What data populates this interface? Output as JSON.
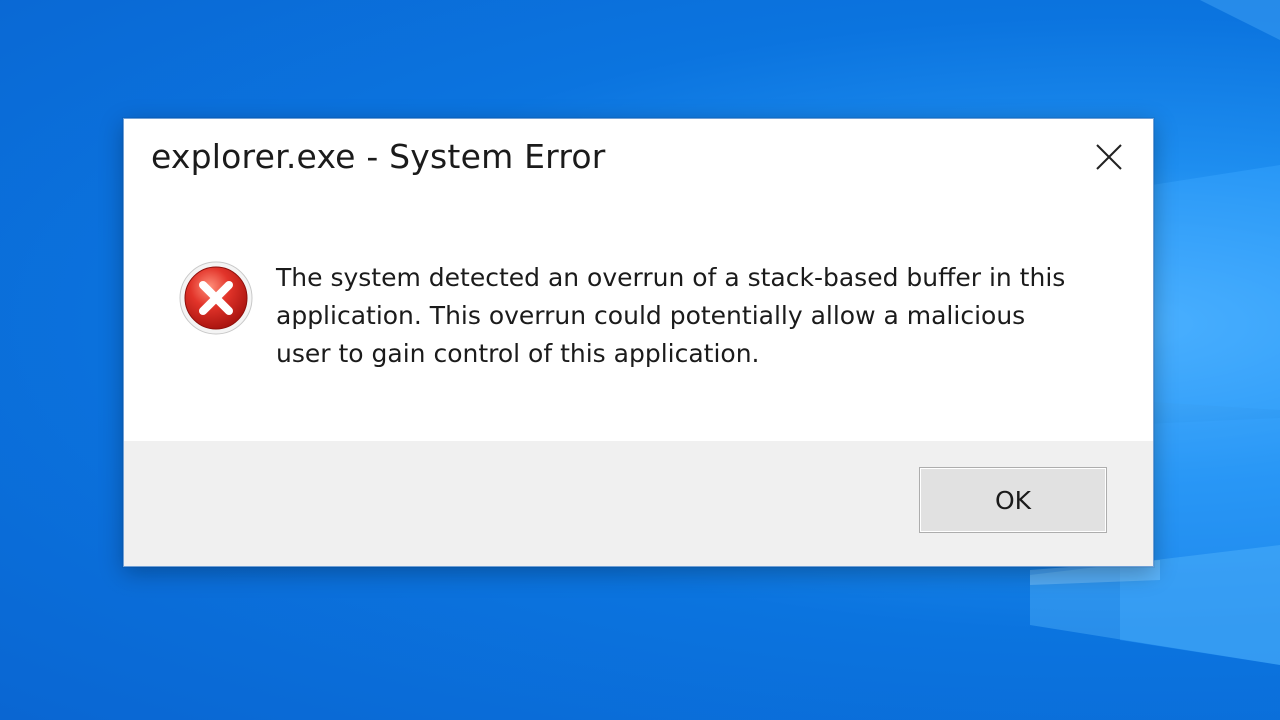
{
  "dialog": {
    "title": "explorer.exe - System Error",
    "icon": "error-icon",
    "close_icon": "close-icon",
    "message_lines": [
      "The system detected an overrun of a stack-based buffer in this",
      "application. This overrun could potentially allow a malicious",
      "user to gain control of this application."
    ],
    "ok_label": "OK"
  },
  "colors": {
    "desktop": "#0b74df",
    "error_red": "#d9261c",
    "dialog_footer": "#f0f0f0"
  }
}
